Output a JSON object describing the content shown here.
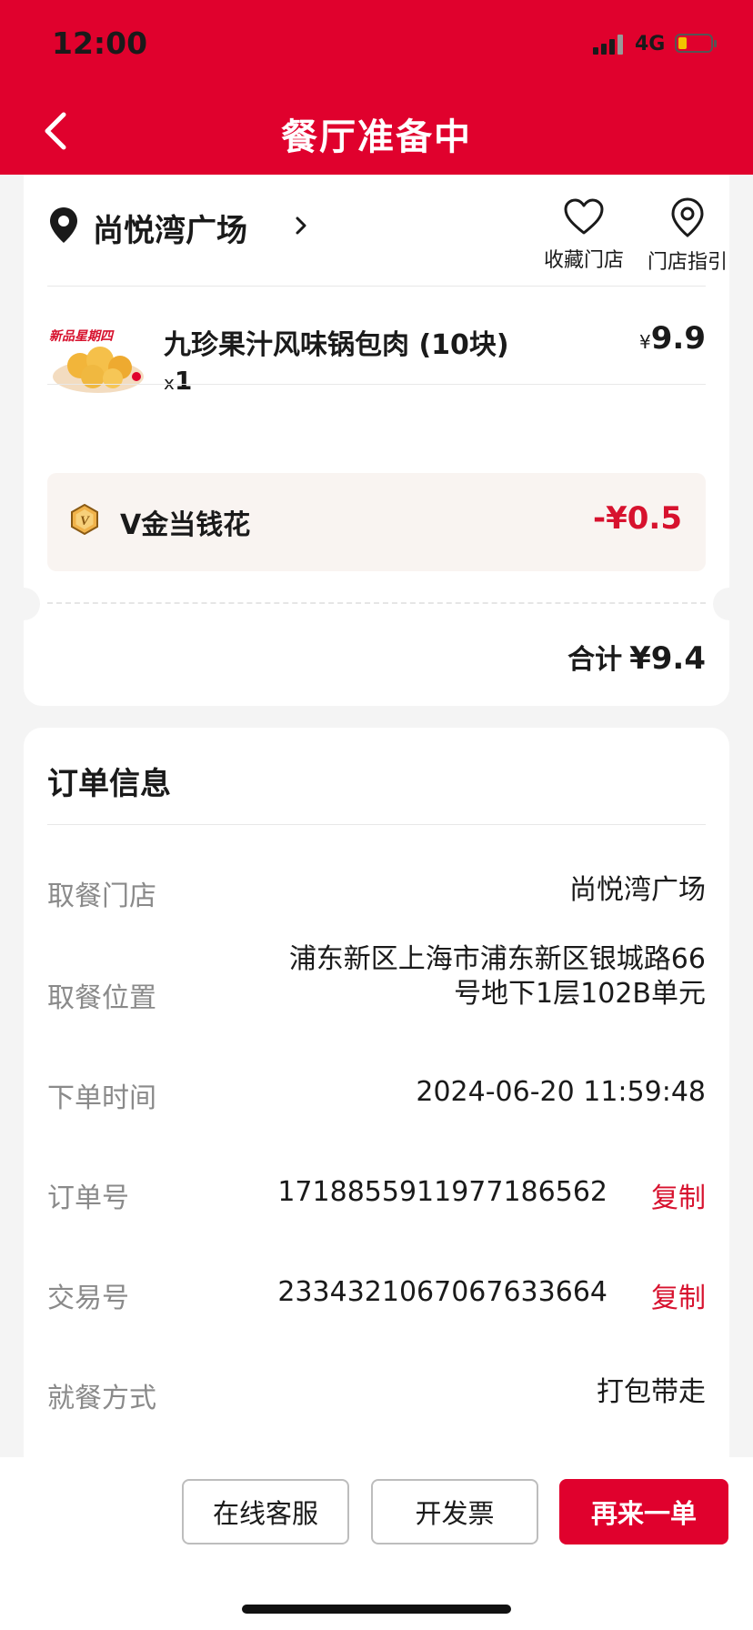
{
  "status_bar": {
    "time": "12:00",
    "network": "4G"
  },
  "nav": {
    "title": "餐厅准备中"
  },
  "store": {
    "name": "尚悦湾广场",
    "favorite_label": "收藏门店",
    "guide_label": "门店指引"
  },
  "product": {
    "name": "九珍果汁风味锅包肉 (10块)",
    "qty_prefix": "x",
    "qty": "1",
    "currency": "¥",
    "price": "9.9",
    "image_caption": "新品星期四"
  },
  "discount": {
    "label": "V金当钱花",
    "amount": "-¥0.5"
  },
  "total": {
    "label": "合计",
    "amount": "¥9.4"
  },
  "order_info": {
    "title": "订单信息",
    "pickup_store_label": "取餐门店",
    "pickup_store": "尚悦湾广场",
    "pickup_location_label": "取餐位置",
    "pickup_location_line1": "浦东新区上海市浦东新区银城路66",
    "pickup_location_line2": "号地下1层102B单元",
    "order_time_label": "下单时间",
    "order_time": "2024-06-20 11:59:48",
    "order_no_label": "订单号",
    "order_no": "1718855911977186562",
    "trade_no_label": "交易号",
    "trade_no": "2334321067067633664",
    "copy_label": "复制",
    "dining_label": "就餐方式",
    "dining": "打包带走"
  },
  "actions": {
    "service": "在线客服",
    "invoice": "开发票",
    "reorder": "再来一单"
  },
  "colors": {
    "brand": "#e0012d",
    "accent_text": "#d7122e"
  }
}
